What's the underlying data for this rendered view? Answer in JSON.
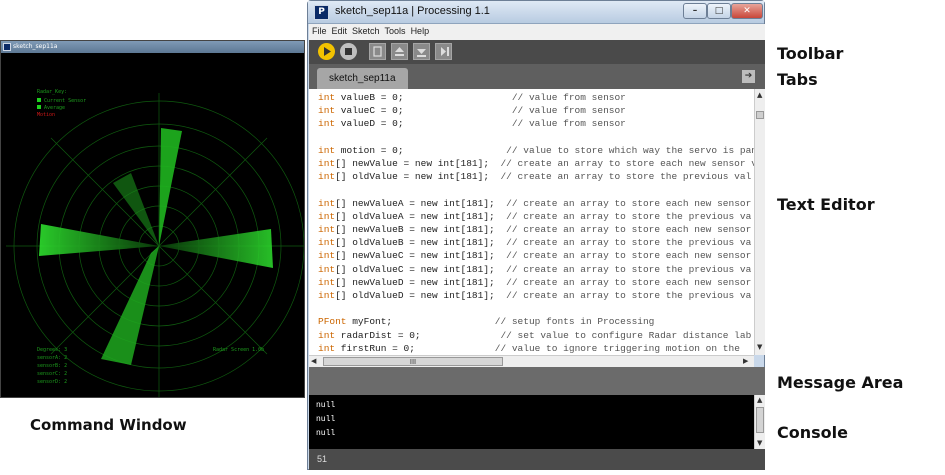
{
  "sketch_window": {
    "title": "sketch_sep11a",
    "legend": [
      "Radar_Key:",
      "Current Sensor",
      "Average",
      "Motion"
    ],
    "bottom_left": [
      "Degrees: 3",
      "sensorA: 2",
      "sensorB: 2",
      "sensorC: 2",
      "sensorD: 2"
    ],
    "bottom_right": "Radar Screen 1.0b"
  },
  "labels": {
    "command_window": "Command Window",
    "toolbar": "Toolbar",
    "tabs": "Tabs",
    "text_editor": "Text Editor",
    "message_area": "Message Area",
    "console": "Console"
  },
  "ide": {
    "title": "sketch_sep11a | Processing 1.1",
    "menu": [
      "File",
      "Edit",
      "Sketch",
      "Tools",
      "Help"
    ],
    "tab": "sketch_sep11a",
    "scroll_glyph": "III",
    "line_number": "51",
    "console_lines": [
      "null",
      "null",
      "null"
    ],
    "code": [
      [
        "int",
        " valueB = 0;",
        "                   // value from sensor"
      ],
      [
        "int",
        " valueC = 0;",
        "                   // value from sensor"
      ],
      [
        "int",
        " valueD = 0;",
        "                   // value from sensor"
      ],
      [
        "",
        "",
        ""
      ],
      [
        "int",
        " motion = 0;",
        "                  // value to store which way the servo is pan"
      ],
      [
        "int",
        "[] newValue = new int[181];",
        "  // create an array to store each new sensor v"
      ],
      [
        "int",
        "[] oldValue = new int[181];",
        "  // create an array to store the previous val"
      ],
      [
        "",
        "",
        ""
      ],
      [
        "int",
        "[] newValueA = new int[181];",
        "  // create an array to store each new sensor"
      ],
      [
        "int",
        "[] oldValueA = new int[181];",
        "  // create an array to store the previous va"
      ],
      [
        "int",
        "[] newValueB = new int[181];",
        "  // create an array to store each new sensor"
      ],
      [
        "int",
        "[] oldValueB = new int[181];",
        "  // create an array to store the previous va"
      ],
      [
        "int",
        "[] newValueC = new int[181];",
        "  // create an array to store each new sensor"
      ],
      [
        "int",
        "[] oldValueC = new int[181];",
        "  // create an array to store the previous va"
      ],
      [
        "int",
        "[] newValueD = new int[181];",
        "  // create an array to store each new sensor"
      ],
      [
        "int",
        "[] oldValueD = new int[181];",
        "  // create an array to store the previous va"
      ],
      [
        "",
        "",
        ""
      ],
      [
        "PFont",
        " myFont;",
        "                  // setup fonts in Processing"
      ],
      [
        "int",
        " radarDist = 0;",
        "              // set value to configure Radar distance lab"
      ],
      [
        "int",
        " firstRun = 0;",
        "              // value to ignore triggering motion on the"
      ]
    ]
  },
  "colors": {
    "radar_green": "#1fd11f",
    "keyword": "#cc6600",
    "run_button": "#f2c200"
  }
}
